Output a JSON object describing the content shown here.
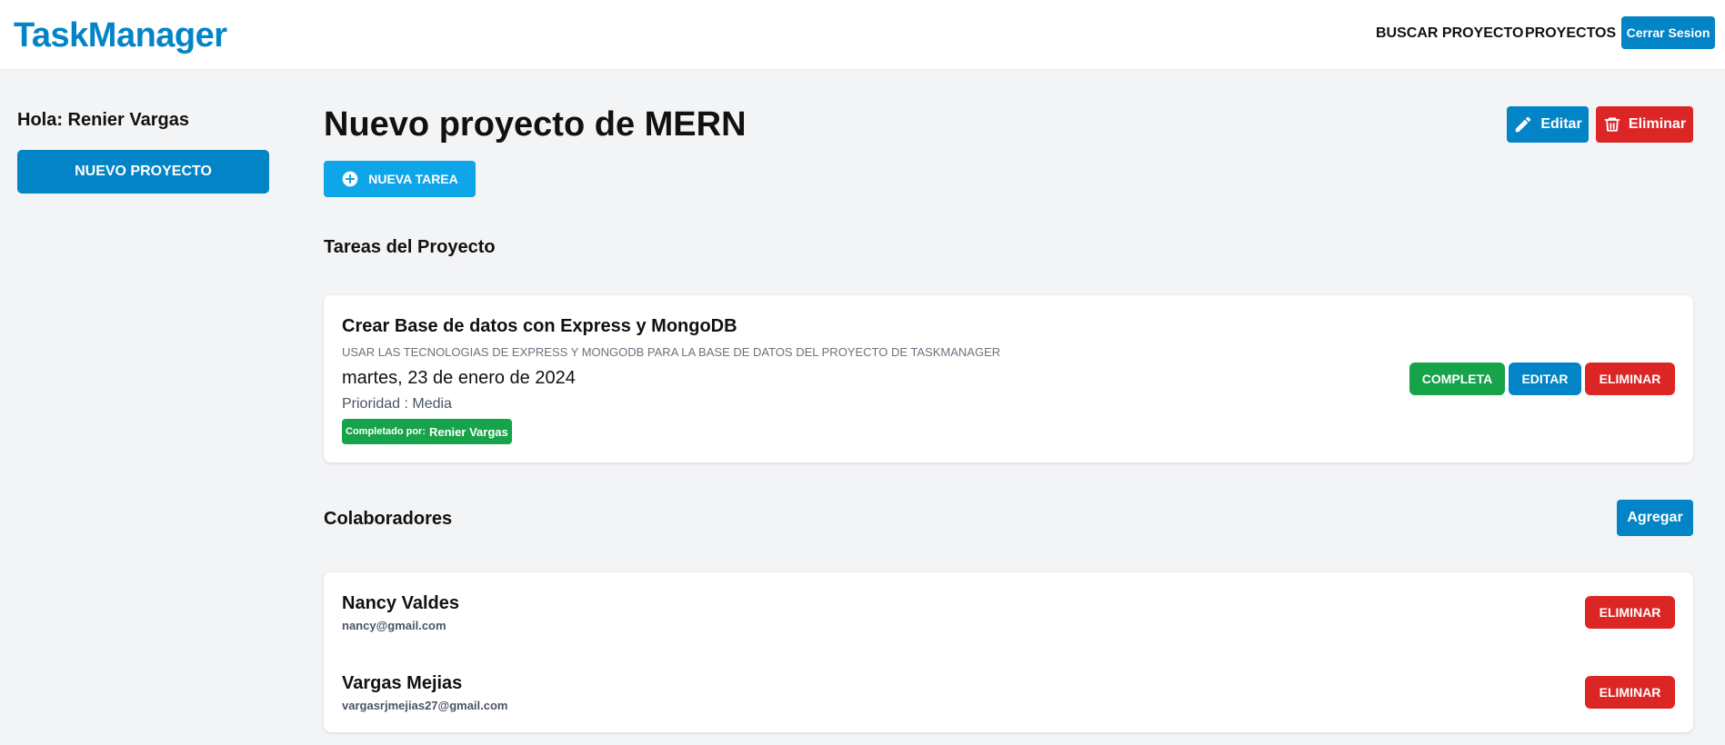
{
  "app": {
    "logo": "TaskManager",
    "nav": {
      "search": "BUSCAR PROYECTO",
      "projects": "PROYECTOS",
      "logout": "Cerrar Sesion"
    }
  },
  "sidebar": {
    "greeting": "Hola: Renier Vargas",
    "new_project": "NUEVO PROYECTO"
  },
  "project": {
    "title": "Nuevo proyecto de MERN",
    "edit": "Editar",
    "delete": "Eliminar",
    "new_task": "NUEVA TAREA"
  },
  "tasks": {
    "title": "Tareas del Proyecto",
    "items": [
      {
        "name": "Crear Base de datos con Express y MongoDB",
        "description": "USAR LAS TECNOLOGIAS DE EXPRESS Y MONGODB PARA LA BASE DE DATOS DEL PROYECTO DE TASKMANAGER",
        "date": "martes, 23 de enero de 2024",
        "priority": "Prioridad : Media",
        "completed_label": "Completado por:",
        "completed_by": "Renier Vargas",
        "btn_complete": "COMPLETA",
        "btn_edit": "EDITAR",
        "btn_delete": "ELIMINAR"
      }
    ]
  },
  "collaborators": {
    "title": "Colaboradores",
    "add": "Agregar",
    "items": [
      {
        "name": "Nancy Valdes",
        "email": "nancy@gmail.com",
        "btn_delete": "ELIMINAR"
      },
      {
        "name": "Vargas Mejias",
        "email": "vargasrjmejias27@gmail.com",
        "btn_delete": "ELIMINAR"
      }
    ]
  },
  "colors": {
    "primary": "#0284c7",
    "sky": "#0ea5e9",
    "success": "#16a34a",
    "danger": "#dc2626",
    "background": "#f3f4f6"
  },
  "icons": {
    "edit": "pencil-icon",
    "delete": "trash-icon",
    "new_task": "plus-circle-icon"
  }
}
